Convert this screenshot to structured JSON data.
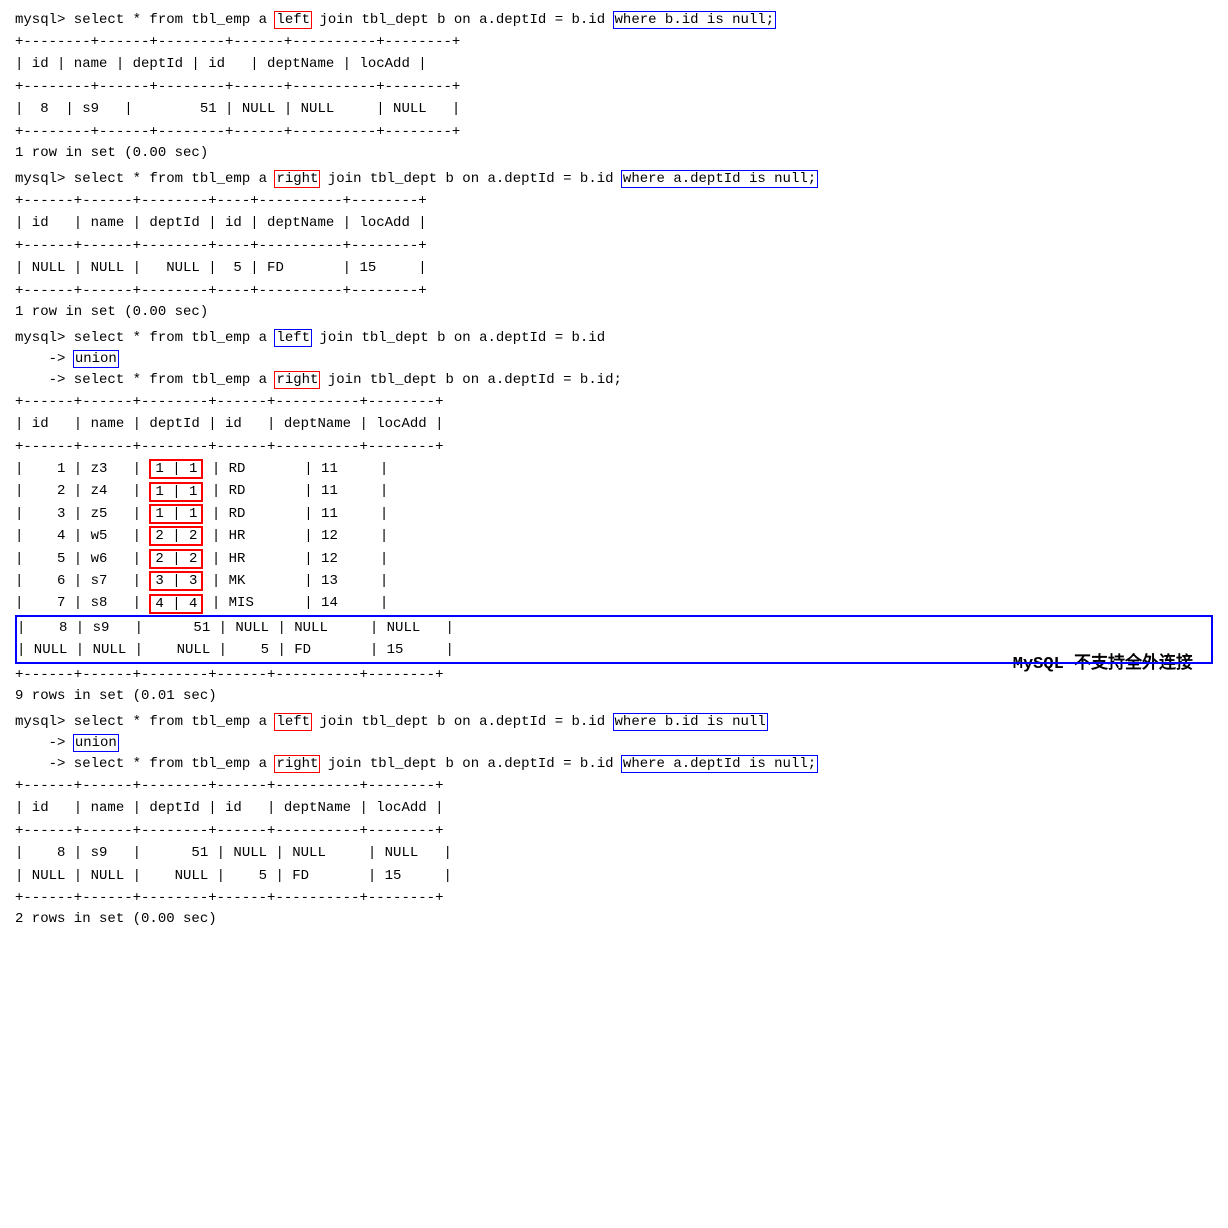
{
  "sections": [
    {
      "id": "section1",
      "query_parts": [
        {
          "text": "mysql> select * from tbl_emp a "
        },
        {
          "text": "left",
          "box": "red"
        },
        {
          "text": " join tbl_dept b on a.deptId = b.id "
        },
        {
          "text": "where b.id is null;",
          "box": "blue"
        }
      ],
      "table_header_sep": "+--------+------+--------+------+----------+--------+",
      "table_header": "| id | name | deptId | id   | deptName | locAdd |",
      "table_sep2": "+--------+------+--------+------+----------+--------+",
      "rows": [
        {
          "text": "|  8  | s9   |        51 | NULL | NULL     | NULL   |",
          "box": ""
        }
      ],
      "table_sep3": "+--------+------+--------+------+----------+--------+",
      "row_count": "1 row in set (0.00 sec)"
    },
    {
      "id": "section2",
      "query_parts": [
        {
          "text": "mysql> select * from tbl_emp a "
        },
        {
          "text": "right",
          "box": "red"
        },
        {
          "text": " join tbl_dept b on a.deptId = b.id "
        },
        {
          "text": "where a.deptId is null;",
          "box": "blue"
        }
      ],
      "table_header_sep": "+------+------+--------+----+----------+--------+",
      "table_header": "| id   | name | deptId | id | deptName | locAdd |",
      "table_sep2": "+------+------+--------+----+----------+--------+",
      "rows": [
        {
          "text": "| NULL | NULL |   NULL |  5 | FD       | 15     |",
          "box": ""
        }
      ],
      "table_sep3": "+------+------+--------+----+----------+--------+",
      "row_count": "1 row in set (0.00 sec)"
    },
    {
      "id": "section3",
      "query_lines": [
        {
          "parts": [
            {
              "text": "mysql> select * from tbl_emp a "
            },
            {
              "text": "left",
              "box": "blue"
            },
            {
              "text": " join tbl_dept b on a.deptId = b.id"
            }
          ]
        },
        {
          "parts": [
            {
              "text": "    -> "
            },
            {
              "text": "union",
              "box": "blue"
            }
          ]
        },
        {
          "parts": [
            {
              "text": "    -> select * from tbl_emp a "
            },
            {
              "text": "right",
              "box": "red"
            },
            {
              "text": " join tbl_dept b on a.deptId = b.id;"
            }
          ]
        }
      ],
      "table_header_sep": "+------+------+--------+------+----------+--------+",
      "table_header": "| id   | name | deptId | id   | deptName | locAdd |",
      "table_sep2": "+------+------+--------+------+----------+--------+",
      "rows": [
        {
          "text": "|    1 | z3   |"
        },
        {
          "text": "|    2 | z4   |"
        },
        {
          "text": "|    3 | z5   |"
        },
        {
          "text": "|    4 | w5   |"
        },
        {
          "text": "|    5 | w6   |"
        },
        {
          "text": "|    6 | s7   |"
        },
        {
          "text": "|    7 | s8   |"
        },
        {
          "text": "|    8 | s9   |      51 | NULL | NULL     | NULL   |",
          "box": "blue"
        },
        {
          "text": "| NULL | NULL |    NULL |    5 | FD       | 15     |",
          "box": "blue"
        }
      ],
      "deptId_cells_red": true,
      "table_sep3": "+------+------+--------+------+----------+--------+",
      "row_count": "9 rows in set (0.01 sec)",
      "note": "MySQL 不支持全外连接"
    },
    {
      "id": "section4",
      "query_lines": [
        {
          "parts": [
            {
              "text": "mysql> select * from tbl_emp a "
            },
            {
              "text": "left",
              "box": "red"
            },
            {
              "text": " join tbl_dept b on a.deptId = b.id "
            },
            {
              "text": "where b.id is null",
              "box": "blue"
            }
          ]
        },
        {
          "parts": [
            {
              "text": "    -> "
            },
            {
              "text": "union",
              "box": "blue"
            }
          ]
        },
        {
          "parts": [
            {
              "text": "    -> select * from tbl_emp a "
            },
            {
              "text": "right",
              "box": "red"
            },
            {
              "text": " join tbl_dept b on a.deptId = b.id "
            },
            {
              "text": "where a.deptId is null;",
              "box": "blue"
            }
          ]
        }
      ],
      "table_header_sep": "+------+------+--------+------+----------+--------+",
      "table_header": "| id   | name | deptId | id   | deptName | locAdd |",
      "table_sep2": "+------+------+--------+------+----------+--------+",
      "rows_text": [
        "|    8 | s9   |      51 | NULL | NULL     | NULL   |",
        "| NULL | NULL |    NULL |    5 | FD       | 15     |"
      ],
      "table_sep3": "+------+------+--------+------+----------+--------+",
      "row_count": "2 rows in set (0.00 sec)"
    }
  ]
}
